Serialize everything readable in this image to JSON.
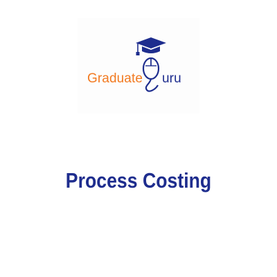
{
  "logo": {
    "brand_part_1": "Graduate",
    "brand_part_2": "uru",
    "colors": {
      "orange": "#f27a21",
      "navy": "#1e2d8e"
    },
    "icons": [
      "graduation-cap-icon",
      "mouse-icon"
    ]
  },
  "title": "Process Costing"
}
